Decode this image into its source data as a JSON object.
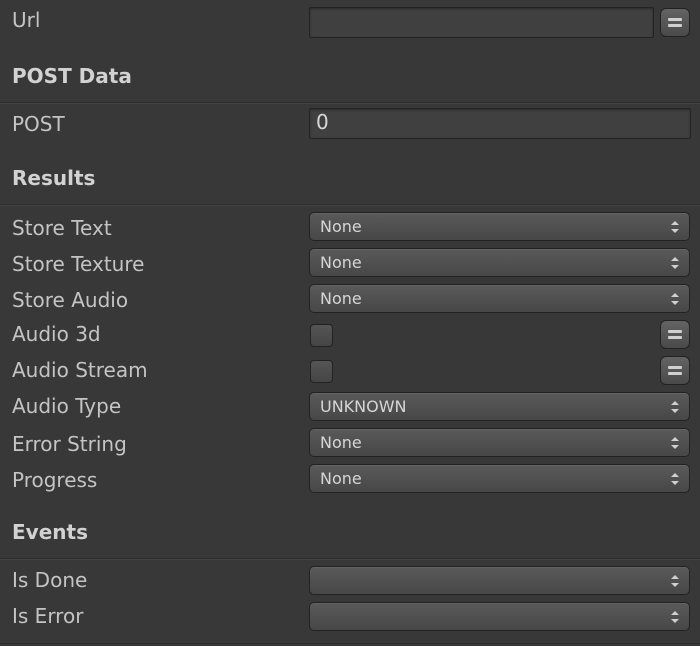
{
  "fields": {
    "url_label": "Url",
    "url_value": "",
    "post_data_header": "POST Data",
    "post_label": "POST",
    "post_value": "0",
    "results_header": "Results",
    "store_text_label": "Store Text",
    "store_text_value": "None",
    "store_texture_label": "Store Texture",
    "store_texture_value": "None",
    "store_audio_label": "Store Audio",
    "store_audio_value": "None",
    "audio_3d_label": "Audio 3d",
    "audio_3d_checked": false,
    "audio_stream_label": "Audio Stream",
    "audio_stream_checked": false,
    "audio_type_label": "Audio Type",
    "audio_type_value": "UNKNOWN",
    "error_string_label": "Error String",
    "error_string_value": "None",
    "progress_label": "Progress",
    "progress_value": "None",
    "events_header": "Events",
    "is_done_label": "Is Done",
    "is_done_value": "",
    "is_error_label": "Is Error",
    "is_error_value": ""
  },
  "colors": {
    "background": "#383838",
    "field_bg": "#404040",
    "text": "#c4c4c4"
  }
}
